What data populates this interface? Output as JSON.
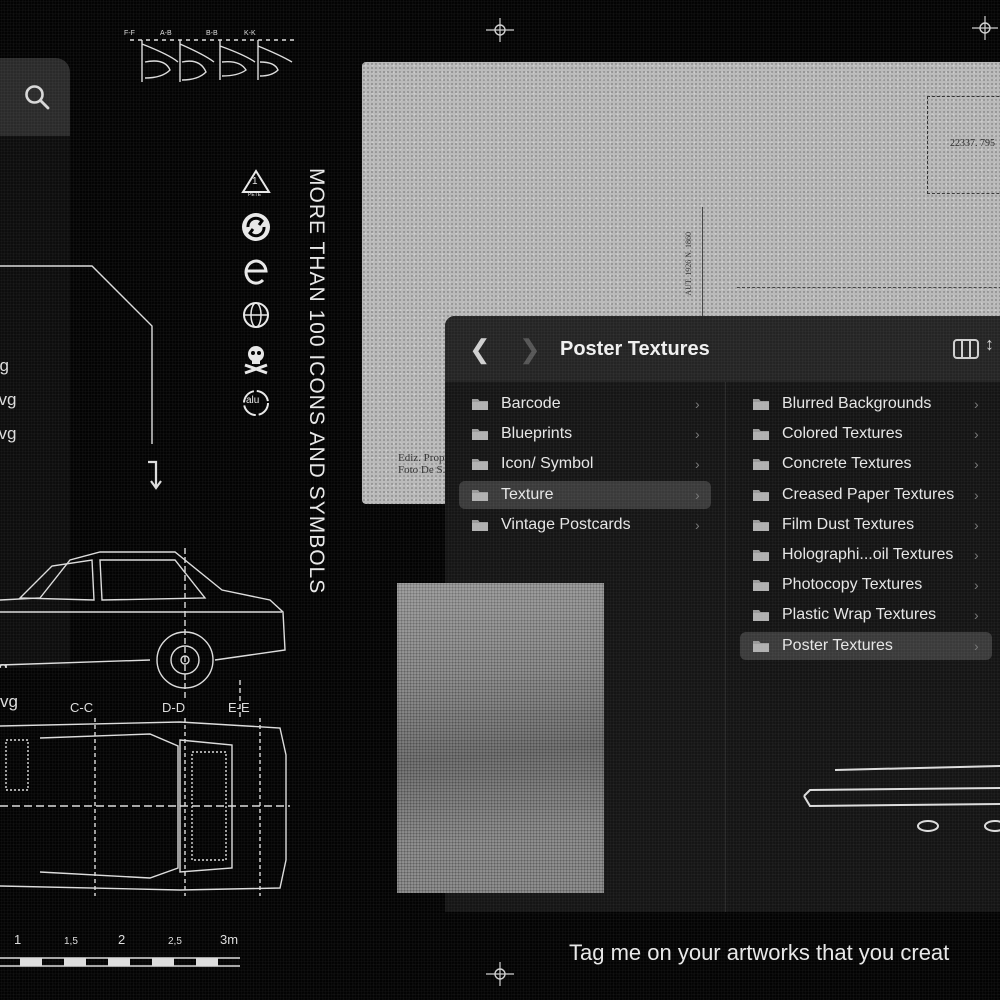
{
  "left_panel": {
    "file_labels": [
      "ng",
      "svg",
      "svg",
      "vg",
      "vg"
    ]
  },
  "blueprint": {
    "section_labels_top": [
      "F-F",
      "A-B",
      "B-B",
      "K-K"
    ],
    "section_labels": [
      "C-C",
      "D-D",
      "E-E"
    ],
    "scale_labels": [
      "1",
      "1,5",
      "2",
      "2,5",
      "3m"
    ]
  },
  "symbols": {
    "recycle_code": "1",
    "recycle_name": "PETE",
    "alu_label": "alu"
  },
  "headline_vertical": "MORE THAN 100 ICONS AND SYMBOLS",
  "postcard": {
    "number": "22337. 795",
    "footer_line1": "Ediz. Propr.",
    "footer_line2": "Foto De S.",
    "vertical_print": "AUT. 1926 N. 1860"
  },
  "finder": {
    "title": "Poster Textures",
    "left_column": [
      {
        "label": "Barcode",
        "selected": false
      },
      {
        "label": "Blueprints",
        "selected": false
      },
      {
        "label": "Icon/ Symbol",
        "selected": false
      },
      {
        "label": "Texture",
        "selected": true
      },
      {
        "label": "Vintage Postcards",
        "selected": false
      }
    ],
    "right_column": [
      {
        "label": "Blurred Backgrounds",
        "selected": false
      },
      {
        "label": "Colored Textures",
        "selected": false
      },
      {
        "label": "Concrete Textures",
        "selected": false
      },
      {
        "label": "Creased Paper Textures",
        "selected": false
      },
      {
        "label": "Film Dust Textures",
        "selected": false
      },
      {
        "label": "Holographi...oil Textures",
        "selected": false
      },
      {
        "label": "Photocopy Textures",
        "selected": false
      },
      {
        "label": "Plastic Wrap Textures",
        "selected": false
      },
      {
        "label": "Poster Textures",
        "selected": true
      }
    ]
  },
  "footer_tagline": "Tag me on your artworks that you creat",
  "colors": {
    "background": "#030303",
    "text": "#e8e8e8",
    "toolbar": "#242424",
    "selection": "#3a3a3a",
    "folder": "#9a9a9a"
  }
}
